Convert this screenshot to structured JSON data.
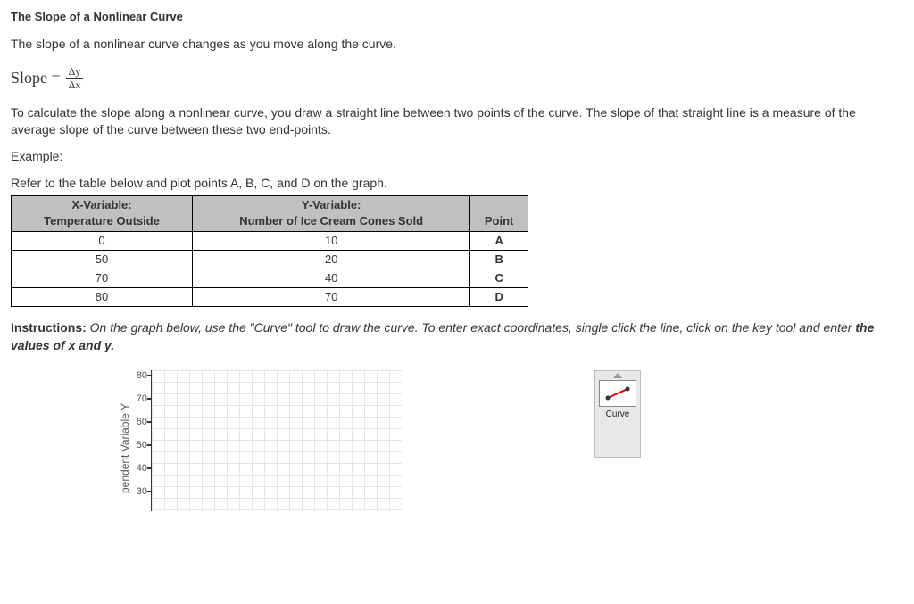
{
  "title": "The Slope of a Nonlinear Curve",
  "intro": "The slope of a nonlinear curve changes as you move along the curve.",
  "formula": {
    "lhs": "Slope =",
    "num": "Δy",
    "den": "Δx"
  },
  "explanation": "To calculate the slope along a nonlinear curve, you draw a straight line between two points of the curve. The slope of that straight line is a measure of the average slope of the curve between these two end-points.",
  "example_label": "Example:",
  "table_intro": "Refer to the table below and plot points A, B, C, and D on the graph.",
  "table": {
    "headers": {
      "x_top": "X-Variable:",
      "x_bottom": "Temperature Outside",
      "y_top": "Y-Variable:",
      "y_bottom": "Number of Ice Cream Cones Sold",
      "point": "Point"
    },
    "rows": [
      {
        "x": "0",
        "y": "10",
        "p": "A"
      },
      {
        "x": "50",
        "y": "20",
        "p": "B"
      },
      {
        "x": "70",
        "y": "40",
        "p": "C"
      },
      {
        "x": "80",
        "y": "70",
        "p": "D"
      }
    ]
  },
  "instructions": {
    "lead": "Instructions:",
    "body1": " On the graph below, use the \"Curve\" tool to draw the curve. To enter exact coordinates, single click the line, click on the key tool and enter ",
    "bold": "the values of x and y."
  },
  "chart_data": {
    "type": "scatter",
    "title": "",
    "xlabel": "",
    "ylabel": "pendent Variable Y",
    "y_ticks": [
      "80",
      "70",
      "60",
      "50",
      "40",
      "30"
    ],
    "ylim": [
      30,
      80
    ],
    "series": []
  },
  "tool": {
    "curve_label": "Curve"
  }
}
